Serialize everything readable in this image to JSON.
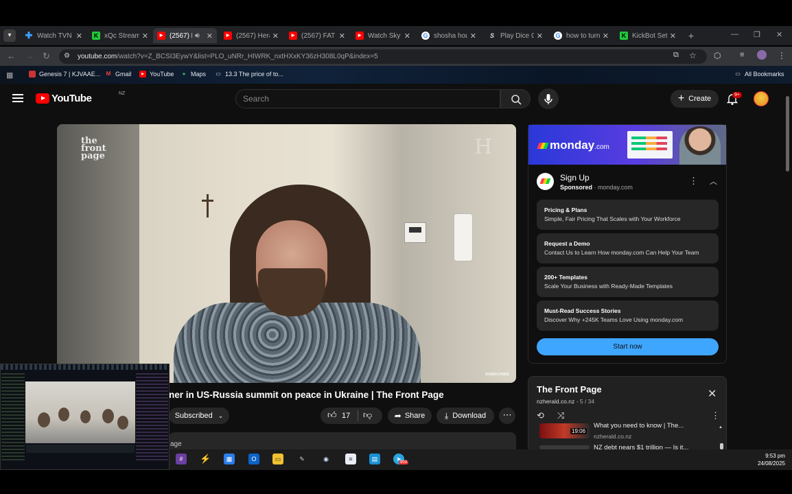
{
  "browser": {
    "tabs": [
      {
        "label": "Watch TVN",
        "active": false,
        "favicon": "plus-icon"
      },
      {
        "label": "xQc Stream",
        "active": false,
        "favicon": "kick-icon"
      },
      {
        "label": "(2567) F",
        "active": true,
        "favicon": "youtube-icon"
      },
      {
        "label": "(2567) Hera",
        "active": false,
        "favicon": "youtube-icon"
      },
      {
        "label": "(2567) FAT",
        "active": false,
        "favicon": "youtube-icon"
      },
      {
        "label": "Watch Sky",
        "active": false,
        "favicon": "youtube-icon"
      },
      {
        "label": "shosha hou",
        "active": false,
        "favicon": "google-icon"
      },
      {
        "label": "Play Dice C",
        "active": false,
        "favicon": "stake-icon"
      },
      {
        "label": "how to turn",
        "active": false,
        "favicon": "google-icon"
      },
      {
        "label": "KickBot Set",
        "active": false,
        "favicon": "kick-icon"
      }
    ],
    "url_domain": "youtube.com",
    "url_rest": "/watch?v=Z_BCSI3EywY&list=PLO_uNRr_HIWRK_nxtHXxKY36zH308L0qP&index=5",
    "bookmarks": [
      {
        "label": "Genesis 7 | KJVAAE...",
        "icon": "bible-icon"
      },
      {
        "label": "Gmail",
        "icon": "gmail-icon"
      },
      {
        "label": "YouTube",
        "icon": "youtube-icon"
      },
      {
        "label": "Maps",
        "icon": "maps-icon"
      },
      {
        "label": "13.3 The price of to...",
        "icon": "page-icon"
      }
    ],
    "all_bookmarks": "All Bookmarks"
  },
  "youtube": {
    "logo_text": "YouTube",
    "country_code": "NZ",
    "search_placeholder": "Search",
    "create_label": "Create",
    "notification_count": "9+"
  },
  "video": {
    "brand_watermark": "the front page",
    "corner_mark": "H",
    "subscribe_overlay": "SUBSCRIBE",
    "title": "ner in US-Russia summit on peace in Ukraine | The Front Page",
    "subscribed_label": "Subscribed",
    "likes": "17",
    "share_label": "Share",
    "download_label": "Download",
    "description_snippet": "age"
  },
  "ad": {
    "brand": "monday",
    "brand_suffix": ".com",
    "title": "Sign Up",
    "sponsored_label": "Sponsored",
    "domain": "monday.com",
    "cards": [
      {
        "heading": "Pricing & Plans",
        "sub": "Simple, Fair Pricing That Scales with Your Workforce"
      },
      {
        "heading": "Request a Demo",
        "sub": "Contact Us to Learn How monday.com Can Help Your Team"
      },
      {
        "heading": "200+ Templates",
        "sub": "Scale Your Business with Ready-Made Templates"
      },
      {
        "heading": "Must-Read Success Stories",
        "sub": "Discover Why +245K Teams Love Using monday.com"
      }
    ],
    "cta": "Start now"
  },
  "playlist": {
    "title": "The Front Page",
    "channel": "nzherald.co.nz",
    "position": "5 / 34",
    "items": [
      {
        "title": "What you need to know | The...",
        "channel": "nzherald.co.nz",
        "duration": "19:06"
      },
      {
        "title": "NZ debt nears $1 trillion — Is it...",
        "channel": "",
        "duration": ""
      }
    ]
  },
  "taskbar": {
    "time": "9:53 pm",
    "date": "24/08/2025",
    "telegram_badge": "903"
  },
  "colors": {
    "yt_bg": "#0f0f0f",
    "yt_red": "#ff0000",
    "cta_blue": "#3ea6ff",
    "monday_purple": "#5a3de0"
  }
}
